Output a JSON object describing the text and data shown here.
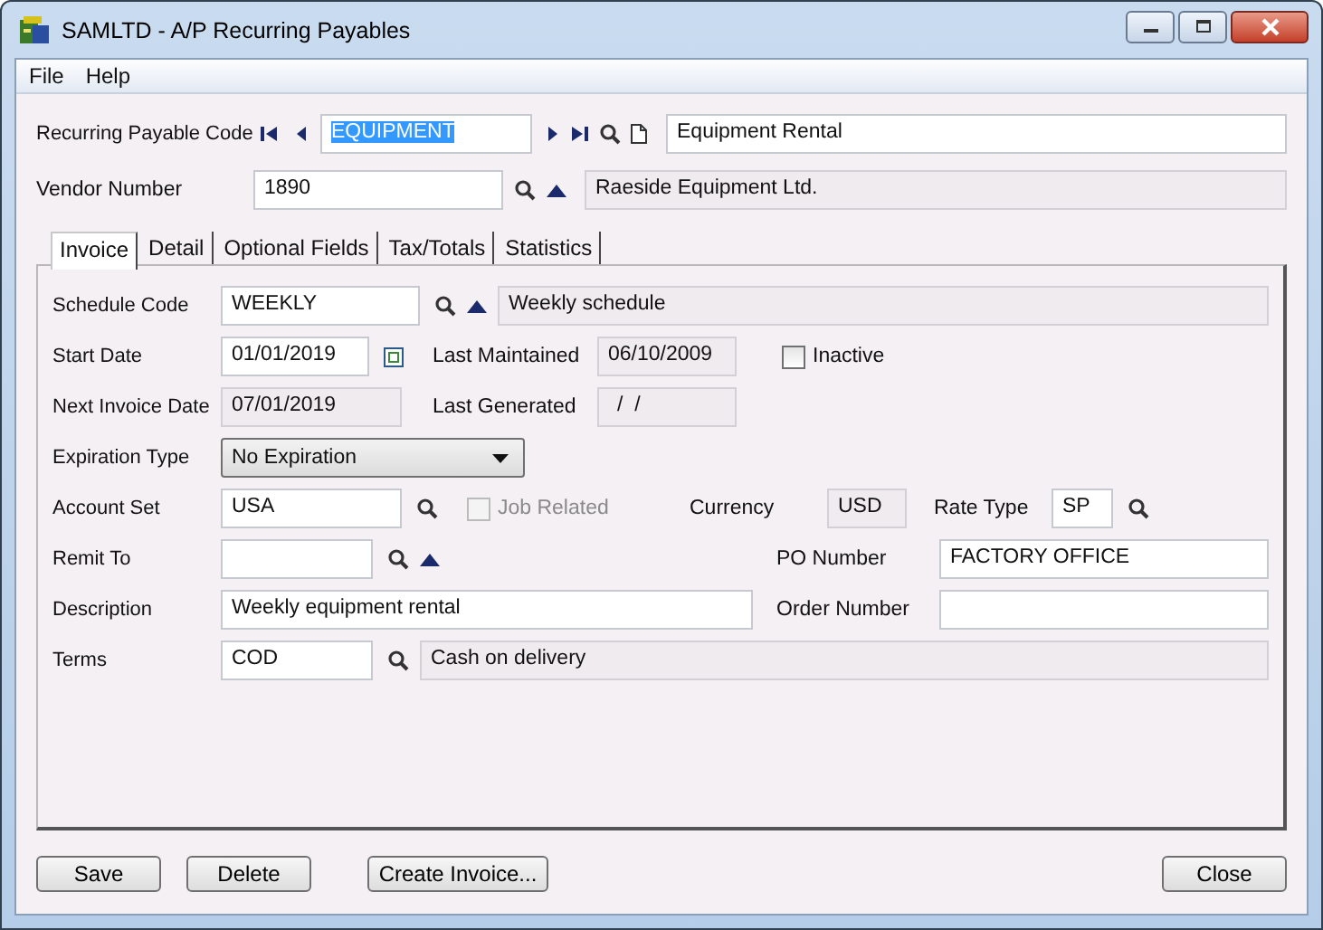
{
  "window": {
    "title": "SAMLTD - A/P Recurring Payables"
  },
  "menu": [
    {
      "label": "File"
    },
    {
      "label": "Help"
    }
  ],
  "recurring_payable_code": {
    "label": "Recurring Payable Code",
    "value": "EQUIPMENT",
    "value_selected": true,
    "description": "Equipment Rental"
  },
  "vendor_number": {
    "label": "Vendor Number",
    "value": "1890",
    "name": "Raeside Equipment Ltd."
  },
  "tabs": [
    {
      "label": "Invoice",
      "selected": true
    },
    {
      "label": "Detail",
      "selected": false
    },
    {
      "label": "Optional Fields",
      "selected": false
    },
    {
      "label": "Tax/Totals",
      "selected": false
    },
    {
      "label": "Statistics",
      "selected": false
    }
  ],
  "invoice": {
    "schedule_code": {
      "label": "Schedule Code",
      "value": "WEEKLY",
      "description": "Weekly schedule"
    },
    "start_date": {
      "label": "Start Date",
      "value": "01/01/2019"
    },
    "last_maintained": {
      "label": "Last Maintained",
      "value": "06/10/2009"
    },
    "inactive": {
      "label": "Inactive",
      "checked": false
    },
    "next_invoice_date": {
      "label": "Next Invoice Date",
      "value": "07/01/2019"
    },
    "last_generated": {
      "label": "Last Generated",
      "value": "/  /"
    },
    "expiration_type": {
      "label": "Expiration Type",
      "value": "No Expiration"
    },
    "account_set": {
      "label": "Account Set",
      "value": "USA"
    },
    "job_related": {
      "label": "Job Related",
      "checked": false,
      "disabled": true
    },
    "currency": {
      "label": "Currency",
      "value": "USD"
    },
    "rate_type": {
      "label": "Rate Type",
      "value": "SP"
    },
    "remit_to": {
      "label": "Remit To"
    },
    "po_number": {
      "label": "PO Number",
      "value": "FACTORY OFFICE"
    },
    "description": {
      "label": "Description",
      "value": "Weekly equipment rental"
    },
    "order_number": {
      "label": "Order Number"
    },
    "terms": {
      "label": "Terms",
      "value": "COD",
      "description": "Cash on delivery"
    }
  },
  "buttons": [
    {
      "label": "Save",
      "kind": "left"
    },
    {
      "label": "Delete",
      "kind": "left"
    },
    {
      "label": "Create Invoice...",
      "kind": "left"
    },
    {
      "label": "Close",
      "kind": "right"
    }
  ]
}
